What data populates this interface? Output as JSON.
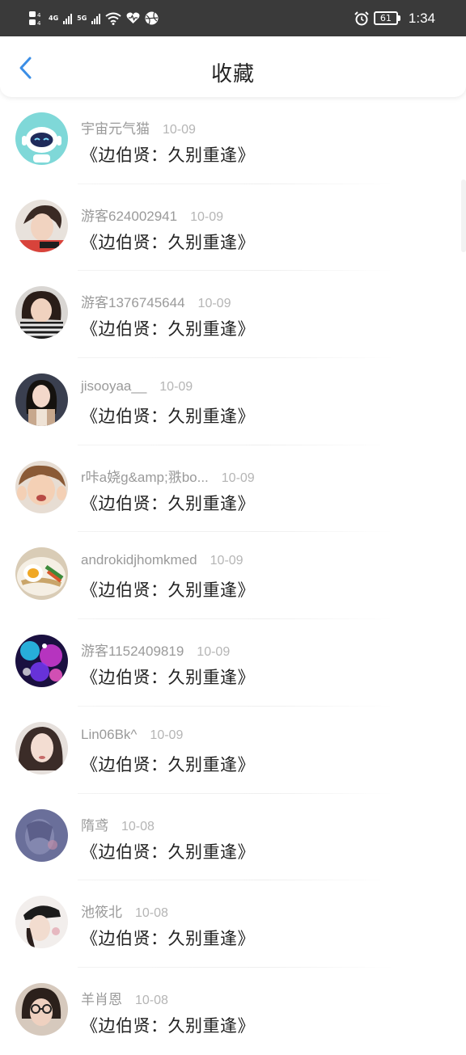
{
  "status_bar": {
    "net1": "4G",
    "net2": "5G",
    "battery": "61",
    "time": "1:34",
    "icons": [
      "hd-icon",
      "signal-icon",
      "wifi-icon",
      "heart-icon",
      "basketball-icon",
      "alarm-icon",
      "battery-icon"
    ]
  },
  "nav": {
    "title": "收藏",
    "back_icon": "chevron-left-icon",
    "accent": "#3b8ee6"
  },
  "favorites": [
    {
      "user": "宇宙元气猫",
      "date": "10-09",
      "title": "《边伯贤：久别重逢》",
      "avatar": "robot-avatar"
    },
    {
      "user": "游客624002941",
      "date": "10-09",
      "title": "《边伯贤：久别重逢》",
      "avatar": "boy-avatar"
    },
    {
      "user": "游客1376745644",
      "date": "10-09",
      "title": "《边伯贤：久别重逢》",
      "avatar": "girl-avatar"
    },
    {
      "user": "jisooyaa__",
      "date": "10-09",
      "title": "《边伯贤：久别重逢》",
      "avatar": "woman-avatar"
    },
    {
      "user": "r咔a娆g&amp;翐bo...",
      "date": "10-09",
      "title": "《边伯贤：久别重逢》",
      "avatar": "child-avatar"
    },
    {
      "user": "androkidjhomkmed",
      "date": "10-09",
      "title": "《边伯贤：久别重逢》",
      "avatar": "food-avatar"
    },
    {
      "user": "游客1152409819",
      "date": "10-09",
      "title": "《边伯贤：久别重逢》",
      "avatar": "sparkle-avatar"
    },
    {
      "user": "Lin06Bk^",
      "date": "10-09",
      "title": "《边伯贤：久别重逢》",
      "avatar": "portrait-avatar"
    },
    {
      "user": "隋鸢",
      "date": "10-08",
      "title": "《边伯贤：久别重逢》",
      "avatar": "art-avatar"
    },
    {
      "user": "池筱北",
      "date": "10-08",
      "title": "《边伯贤：久别重逢》",
      "avatar": "hat-avatar"
    },
    {
      "user": "羊肖恩",
      "date": "10-08",
      "title": "《边伯贤：久别重逢》",
      "avatar": "glasses-avatar"
    }
  ]
}
